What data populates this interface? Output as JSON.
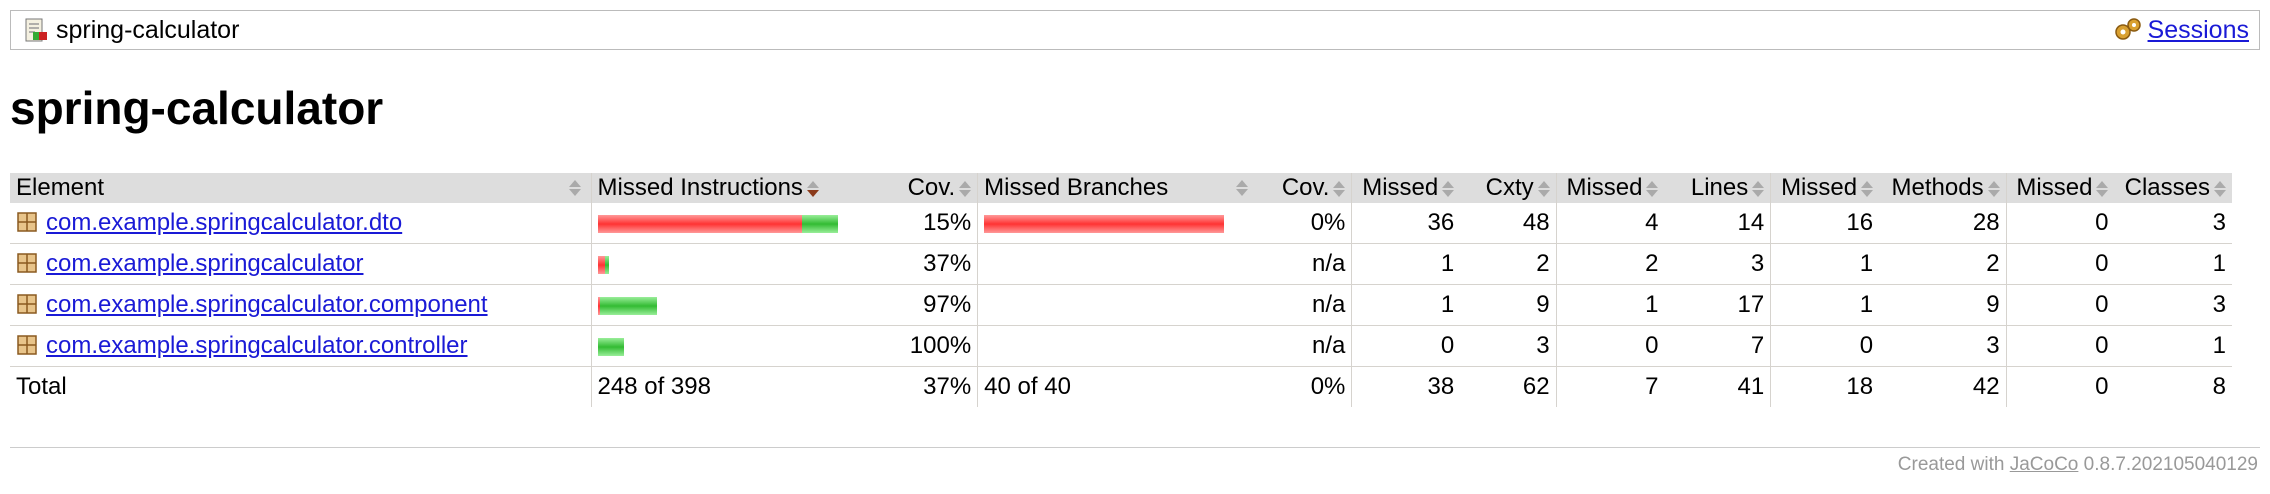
{
  "breadcrumb": {
    "report_name": "spring-calculator",
    "icon": "report-icon",
    "sessions_label": "Sessions",
    "sessions_icon": "gear-icon"
  },
  "page_title": "spring-calculator",
  "table": {
    "headers": [
      "Element",
      "Missed Instructions",
      "Cov.",
      "Missed Branches",
      "Cov.",
      "Missed",
      "Cxty",
      "Missed",
      "Lines",
      "Missed",
      "Methods",
      "Missed",
      "Classes"
    ],
    "sorted_column": "Missed Instructions",
    "rows": [
      {
        "element": "com.example.springcalculator.dto",
        "instr_missed_fraction": 0.85,
        "instr_covered_fraction": 0.15,
        "instr_cov": "15%",
        "branch_missed_fraction": 1.0,
        "branch_cov": "0%",
        "cxty_missed": "36",
        "cxty": "48",
        "lines_missed": "4",
        "lines": "14",
        "methods_missed": "16",
        "methods": "28",
        "classes_missed": "0",
        "classes": "3"
      },
      {
        "element": "com.example.springcalculator",
        "instr_missed_fraction": 0.63,
        "instr_covered_fraction": 0.37,
        "instr_cov": "37%",
        "branch_cov": "n/a",
        "cxty_missed": "1",
        "cxty": "2",
        "lines_missed": "2",
        "lines": "3",
        "methods_missed": "1",
        "methods": "2",
        "classes_missed": "0",
        "classes": "1"
      },
      {
        "element": "com.example.springcalculator.component",
        "instr_missed_fraction": 0.03,
        "instr_covered_fraction": 0.97,
        "instr_cov": "97%",
        "branch_cov": "n/a",
        "cxty_missed": "1",
        "cxty": "9",
        "lines_missed": "1",
        "lines": "17",
        "methods_missed": "1",
        "methods": "9",
        "classes_missed": "0",
        "classes": "3"
      },
      {
        "element": "com.example.springcalculator.controller",
        "instr_missed_fraction": 0.0,
        "instr_covered_fraction": 1.0,
        "instr_cov": "100%",
        "branch_cov": "n/a",
        "cxty_missed": "0",
        "cxty": "3",
        "lines_missed": "0",
        "lines": "7",
        "methods_missed": "0",
        "methods": "3",
        "classes_missed": "0",
        "classes": "1"
      }
    ],
    "total": {
      "label": "Total",
      "instructions": "248 of 398",
      "instr_cov": "37%",
      "branches": "40 of 40",
      "branch_cov": "0%",
      "cxty_missed": "38",
      "cxty": "62",
      "lines_missed": "7",
      "lines": "41",
      "methods_missed": "18",
      "methods": "42",
      "classes_missed": "0",
      "classes": "8"
    }
  },
  "footer": {
    "prefix": "Created with",
    "link": "JaCoCo",
    "version": "0.8.7.202105040129"
  },
  "colors": {
    "missed": "#ff3333",
    "covered": "#33bb33",
    "link": "#1a1ad6"
  }
}
